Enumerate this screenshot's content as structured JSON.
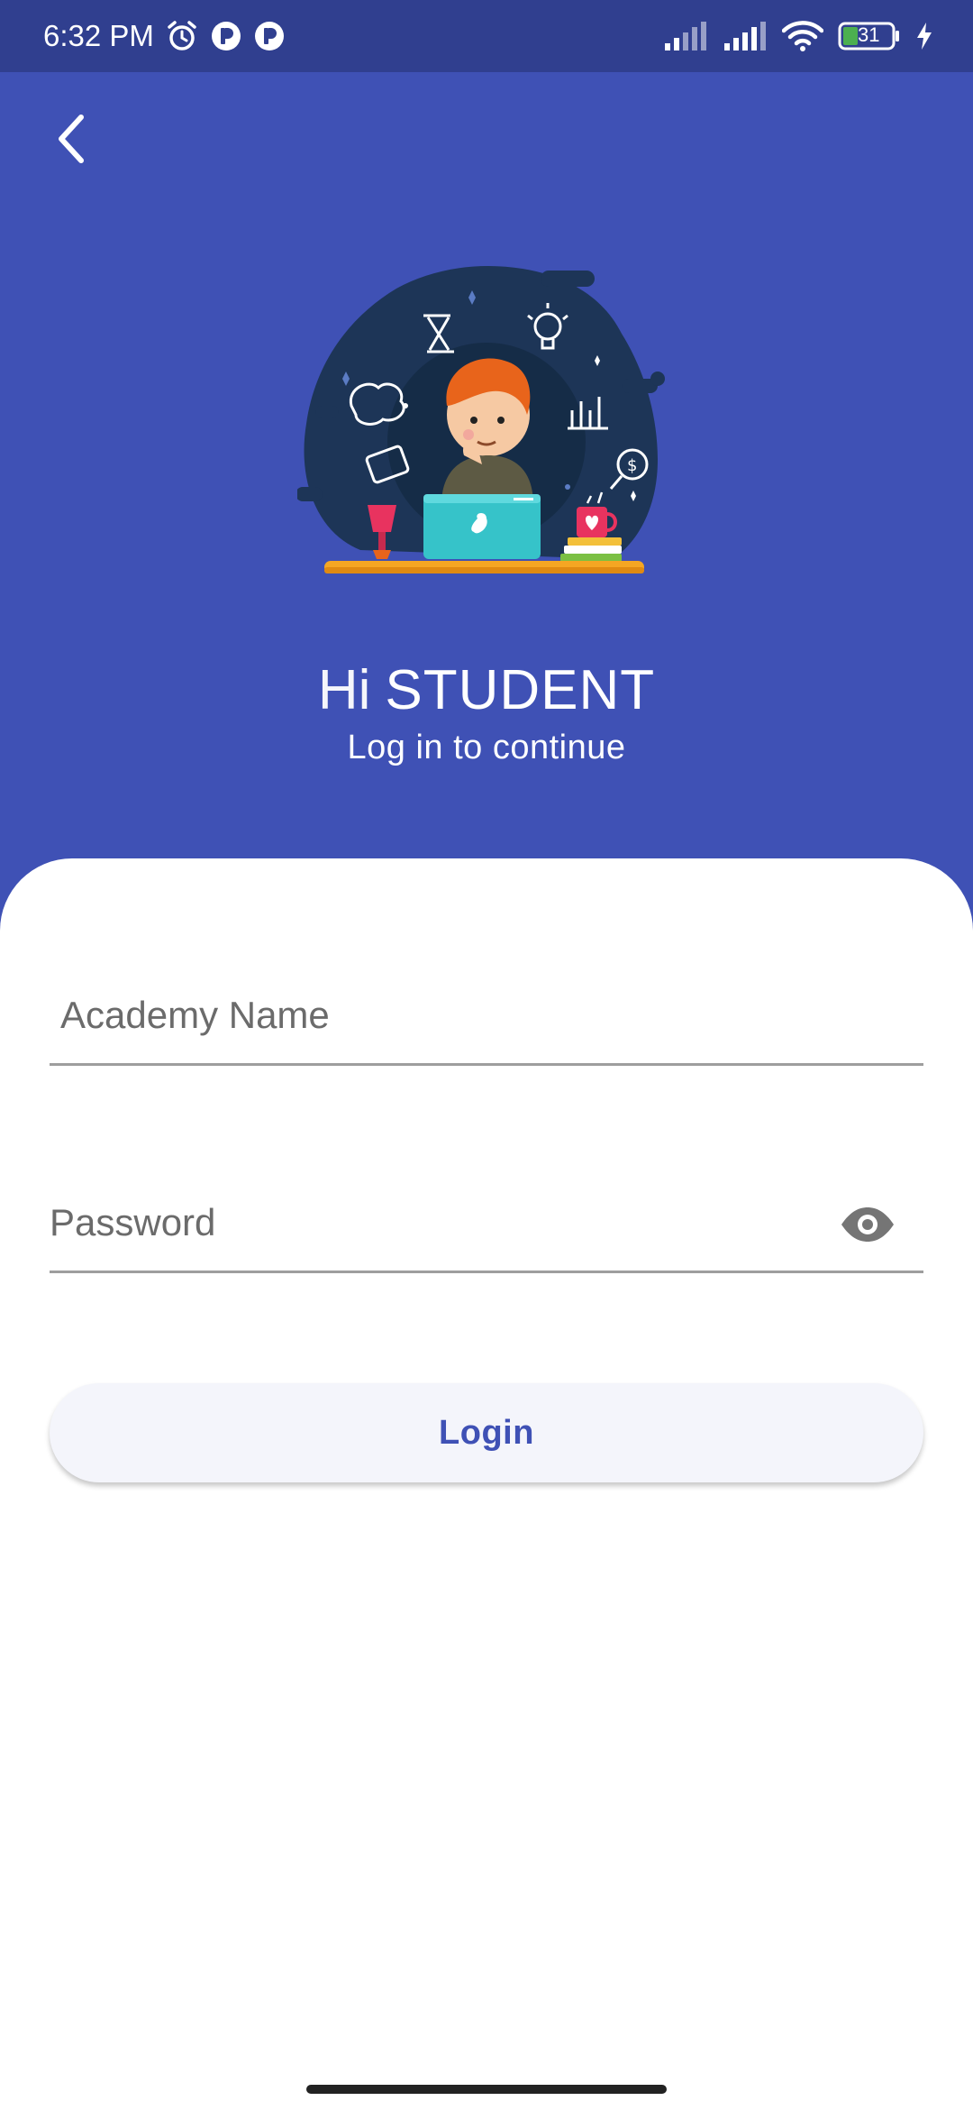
{
  "status_bar": {
    "time": "6:32 PM",
    "battery_level": "31",
    "icons": [
      "alarm-icon",
      "app-notification-icon",
      "app-notification-icon",
      "signal-icon",
      "signal-icon",
      "wifi-icon",
      "battery-icon",
      "charging-icon"
    ]
  },
  "header": {
    "back_icon": "chevron-left-icon",
    "greeting_hi": "Hi",
    "greeting_role": "STUDENT",
    "subtitle": "Log in to continue"
  },
  "form": {
    "academy_placeholder": "Academy Name",
    "password_placeholder": "Password",
    "password_toggle_icon": "eye-icon",
    "login_label": "Login"
  },
  "colors": {
    "primary": "#3f51b5",
    "status_bar": "#303f8f",
    "card": "#ffffff",
    "button_bg": "#f4f5fb"
  }
}
